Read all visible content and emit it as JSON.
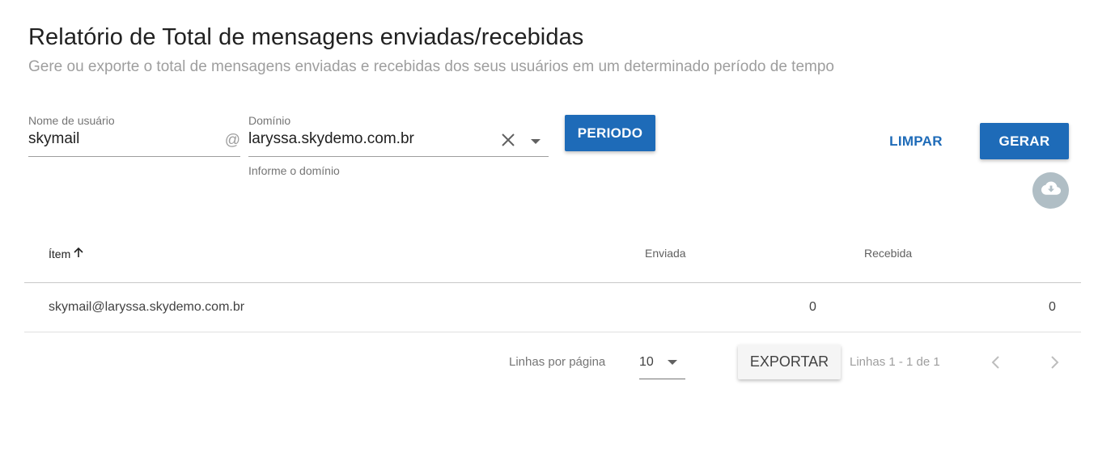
{
  "header": {
    "title": "Relatório de Total de mensagens enviadas/recebidas",
    "subtitle": "Gere ou exporte o total de mensagens enviadas e recebidas dos seus usuários em um determinado período de tempo"
  },
  "filters": {
    "username_label": "Nome de usuário",
    "username_value": "skymail",
    "at_symbol": "@",
    "domain_label": "Domínio",
    "domain_value": "laryssa.skydemo.com.br",
    "domain_hint": "Informe o domínio"
  },
  "actions": {
    "periodo_label": "PERIODO",
    "limpar_label": "LIMPAR",
    "gerar_label": "GERAR"
  },
  "table": {
    "columns": {
      "item": "Ítem",
      "enviada": "Enviada",
      "recebida": "Recebida"
    },
    "rows": [
      {
        "item": "skymail@laryssa.skydemo.com.br",
        "enviada": "0",
        "recebida": "0"
      }
    ]
  },
  "footer": {
    "rows_per_page_label": "Linhas por página",
    "rows_per_page_value": "10",
    "export_label": "EXPORTAR",
    "range_label": "Linhas 1 - 1 de 1"
  },
  "colors": {
    "primary": "#1e6bb8",
    "download_bg": "#b0bec5"
  }
}
